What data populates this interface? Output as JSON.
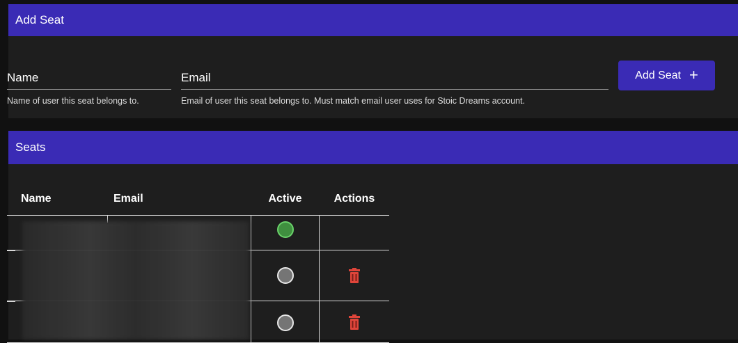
{
  "add_seat": {
    "title": "Add Seat",
    "name_field": {
      "placeholder": "Name",
      "helper": "Name of user this seat belongs to."
    },
    "email_field": {
      "placeholder": "Email",
      "helper": "Email of user this seat belongs to. Must match email user uses for Stoic Dreams account."
    },
    "submit_label": "Add Seat",
    "submit_icon": "plus-icon"
  },
  "seats": {
    "title": "Seats",
    "columns": [
      "Name",
      "Email",
      "Active",
      "Actions"
    ],
    "rows": [
      {
        "active": true,
        "delete_icon": null
      },
      {
        "active": false,
        "delete_icon": "trash-icon"
      },
      {
        "active": false,
        "delete_icon": "trash-icon"
      }
    ]
  },
  "colors": {
    "header_bar": "#3a2bb5",
    "card_bg": "#1e1e1e",
    "page_bg": "#111111",
    "active_green": "#6ad26a",
    "delete_red": "#e0453a"
  }
}
